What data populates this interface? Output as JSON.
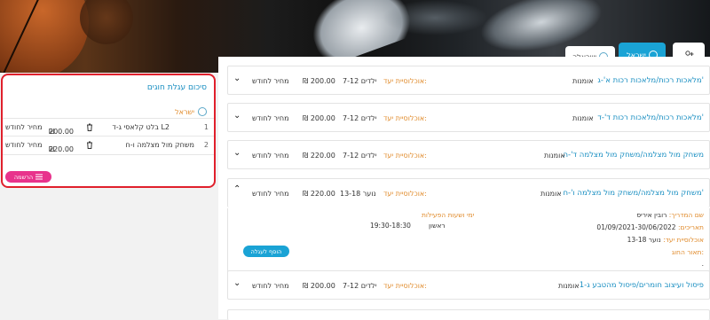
{
  "header": {
    "tabs": [
      {
        "label": "ישראל",
        "active": true
      },
      {
        "label": "ישראלה",
        "active": false
      }
    ]
  },
  "courses": [
    {
      "title": "מלאכות רכות/מלאכות רכות א'-ג'",
      "category": "אומנות",
      "audience_label": "אוכלוסיית יעד:",
      "audience": "ילדים 7-12",
      "price": "200.00",
      "currency": "₪",
      "period": "מחיר לחודש",
      "expanded": false
    },
    {
      "title": "מלאכות רכות/מלאכות רכות ד'-ד'",
      "category": "אומנות",
      "audience_label": "אוכלוסיית יעד:",
      "audience": "ילדים 7-12",
      "price": "200.00",
      "currency": "₪",
      "period": "מחיר לחודש",
      "expanded": false
    },
    {
      "title": "משחק מול מצלמה/משחק מול מצלמה ד'-ה",
      "category": "אומנות",
      "audience_label": "אוכלוסיית יעד:",
      "audience": "ילדים 7-12",
      "price": "220.00",
      "currency": "₪",
      "period": "מחיר לחודש",
      "expanded": false
    },
    {
      "title": "משחק מול מצלמה/משחק מול מצלמה ו'-ח'",
      "category": "אומנות",
      "audience_label": "אוכלוסיית יעד:",
      "audience": "נוער 13-18",
      "price": "220.00",
      "currency": "₪",
      "period": "מחיר לחודש",
      "expanded": true
    },
    {
      "title": "פיסול ועיצוב חומרים/פיסול מהטבע ג-1",
      "category": "אומנות",
      "audience_label": "אוכלוסיית יעד:",
      "audience": "ילדים 7-12",
      "price": "200.00",
      "currency": "₪",
      "period": "מחיר לחודש",
      "expanded": false
    }
  ],
  "details": {
    "instructor_label": "שם המדריך:",
    "instructor": "רובין איריס",
    "dates_label": "תאריכים:",
    "dates": "01/09/2021-30/06/2022",
    "audience_label": "אוכלוסיית יעד:",
    "audience": "נוער 13-18",
    "description_label": "תאור החוג:",
    "description": ".",
    "schedule_header": "ימי ושעות הפעילות",
    "day": "ראשון",
    "hours": "19:30-18:30",
    "join_label": "הוסף לעגלה"
  },
  "sidebar": {
    "title": "סיכום עגלת חוגים",
    "location": "ישראל",
    "items": [
      {
        "index": "1",
        "name": "בלט קלאסי ג-ד L2",
        "price": "200.00",
        "currency": "₪",
        "period": "מחיר לחודש"
      },
      {
        "index": "2",
        "name": "משחק מול מצלמה ו-ח",
        "price": "220.00",
        "currency": "₪",
        "period": "מחיר לחודש"
      }
    ],
    "register_label": "הרשמה"
  },
  "colors": {
    "accent": "#1aa3d5",
    "highlight": "#e08a2a",
    "register": "#e8338c",
    "sidebar_border": "#e0202c"
  }
}
